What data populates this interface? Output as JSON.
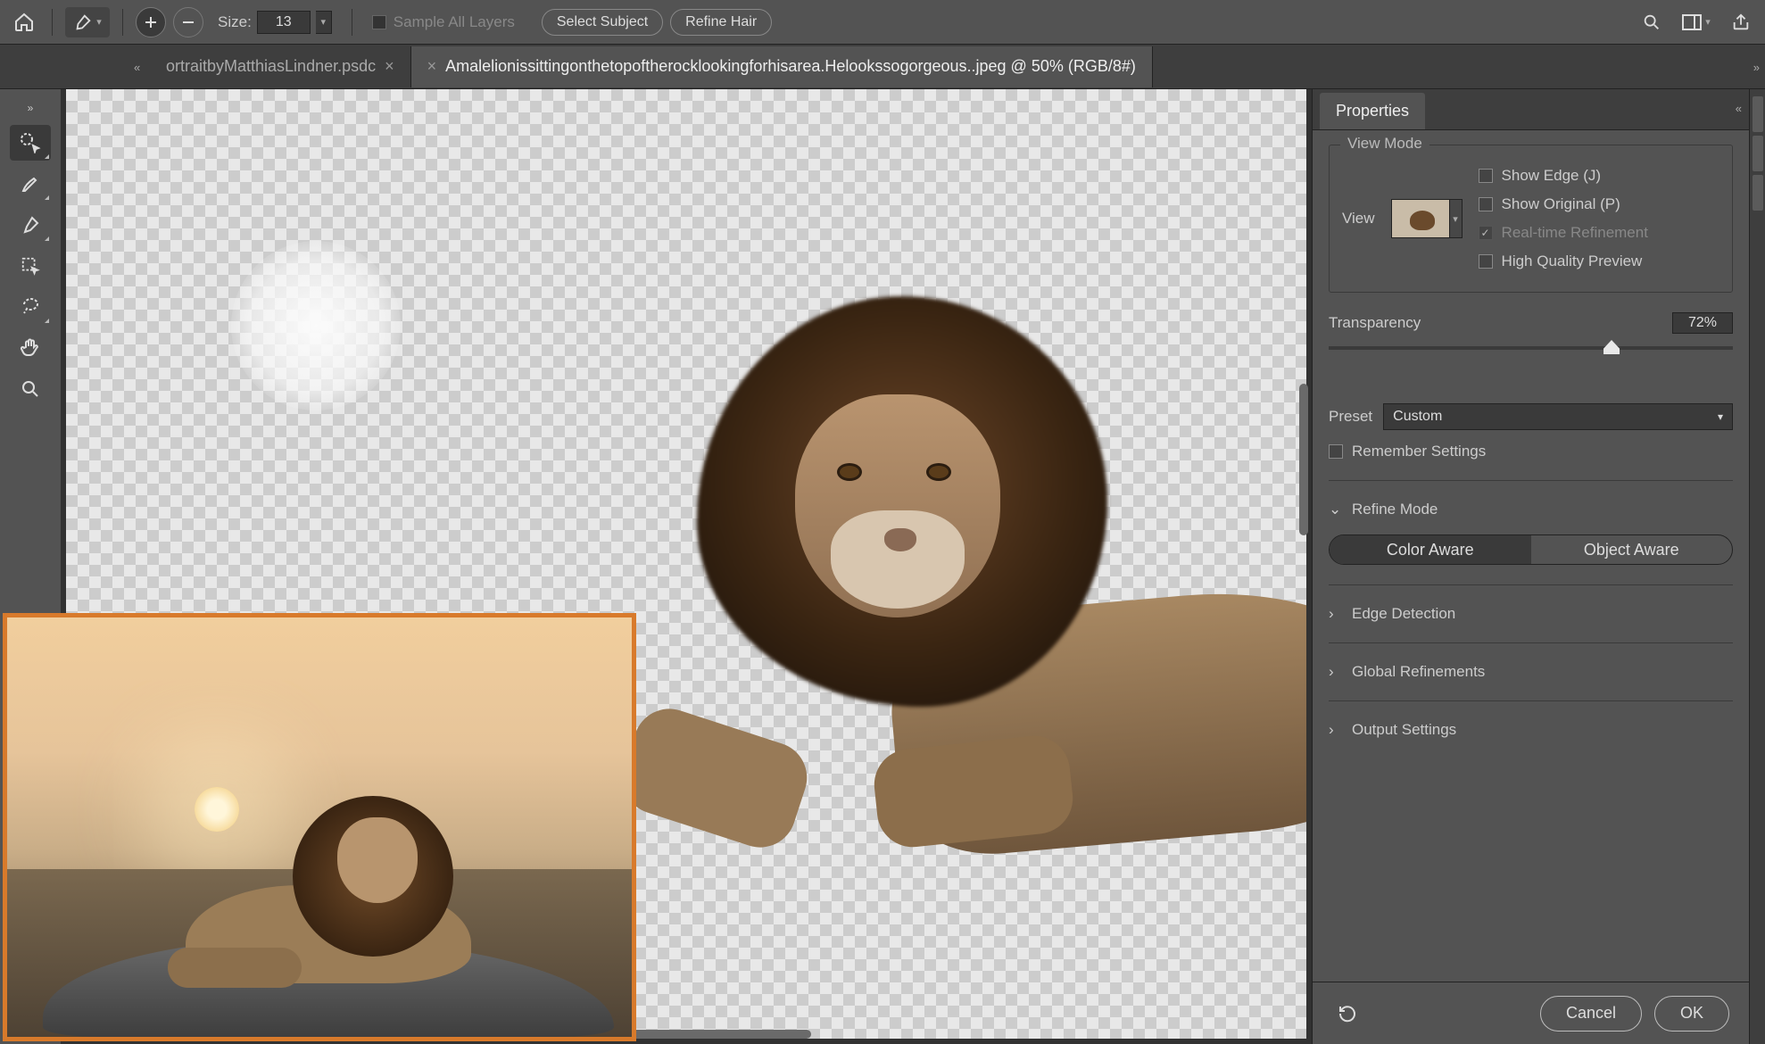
{
  "toolbar": {
    "size_label": "Size:",
    "size_value": "13",
    "sample_all_label": "Sample All Layers",
    "select_subject_label": "Select Subject",
    "refine_hair_label": "Refine Hair"
  },
  "tabs": {
    "inactive_label": "ortraitbyMatthiasLindner.psdc",
    "active_label": "Amalelionissittingonthetopoftherocklookingforhisarea.Helookssogorgeous..jpeg @ 50% (RGB/8#)"
  },
  "panel": {
    "title": "Properties",
    "view_mode_label": "View Mode",
    "view_label": "View",
    "show_edge_label": "Show Edge (J)",
    "show_original_label": "Show Original (P)",
    "realtime_label": "Real-time Refinement",
    "hq_preview_label": "High Quality Preview",
    "transparency_label": "Transparency",
    "transparency_value": "72%",
    "preset_label": "Preset",
    "preset_value": "Custom",
    "remember_label": "Remember Settings",
    "refine_mode_label": "Refine Mode",
    "color_aware_label": "Color Aware",
    "object_aware_label": "Object Aware",
    "edge_detection_label": "Edge Detection",
    "global_refine_label": "Global Refinements",
    "output_settings_label": "Output Settings",
    "cancel_label": "Cancel",
    "ok_label": "OK"
  }
}
